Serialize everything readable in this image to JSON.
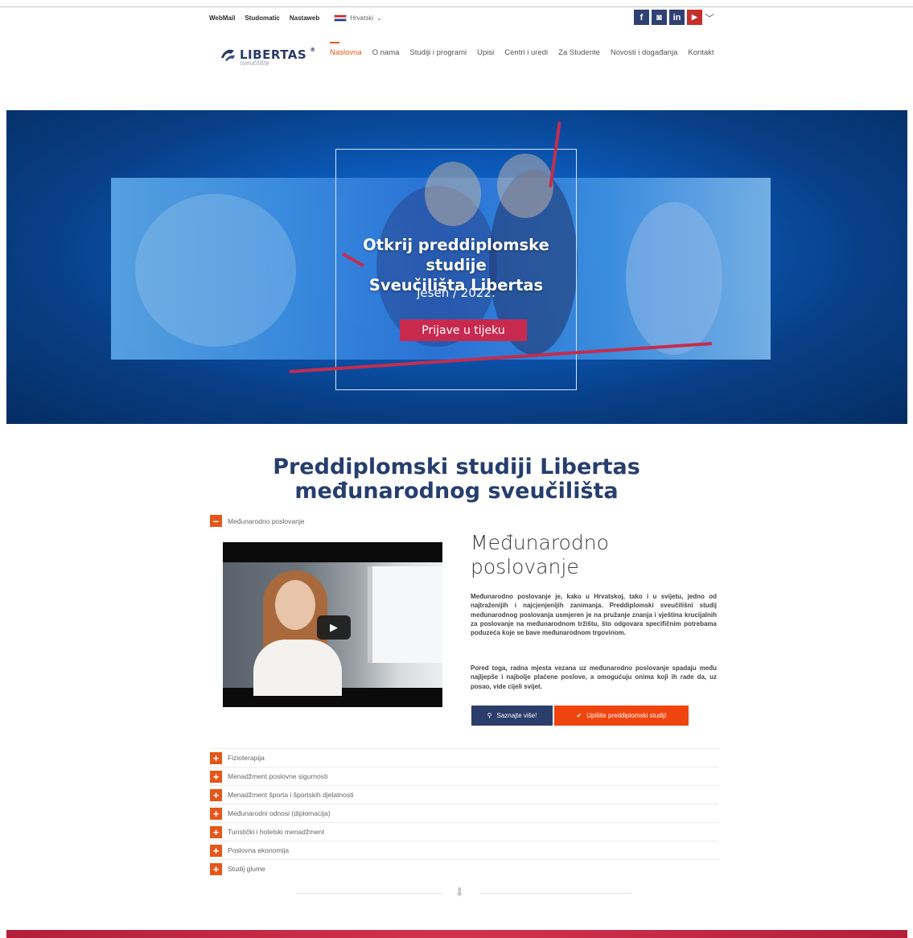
{
  "utility": {
    "links": [
      "WebMail",
      "Studomatic",
      "Nastaweb"
    ],
    "language": "Hrvatski"
  },
  "social": [
    {
      "icon": "facebook-icon",
      "glyph": "f"
    },
    {
      "icon": "instagram-icon",
      "glyph": "◙"
    },
    {
      "icon": "linkedin-icon",
      "glyph": "in"
    },
    {
      "icon": "youtube-icon",
      "glyph": "▶"
    }
  ],
  "logo": {
    "name": "LIBERTAS",
    "registered": "®",
    "sub": "sveučilište"
  },
  "nav": {
    "items": [
      "Naslovna",
      "O nama",
      "Studiji i programi",
      "Upisi",
      "Centri i uredi",
      "Za Studente",
      "Novosti i događanja",
      "Kontakt"
    ],
    "active": "Naslovna"
  },
  "hero": {
    "title_line1": "Otkrij preddiplomske studije",
    "title_line2": "Sveučilišta Libertas",
    "subtitle": "jesen / 2022.",
    "button": "Prijave u tijeku"
  },
  "section": {
    "title_line1": "Preddiplomski studiji Libertas",
    "title_line2": "međunarodnog sveučilišta"
  },
  "open_program": {
    "accordion_label": "Međunarodno poslovanje",
    "title_line1": "Međunarodno",
    "title_line2": "poslovanje",
    "paragraph1": "Međunarodno poslovanje je, kako u Hrvatskoj, tako i u svijetu, jedno od najtraženijih i najcjenjenijih zanimanja. Preddiplomski sveučilišni studij međunarodnog poslovanja usmjeren je na pružanje znanja i vještina krucijalnih za poslovanje na međunarodnom tržištu, što odgovara specifičnim potrebama poduzeća koje se bave međunarodnom trgovinom.",
    "paragraph2": "Pored toga, radna mjesta vezana uz međunarodno poslovanje spadaju među najljepše i najbolje plaćene poslove, a omogućuju onima koji ih rade da, uz posao, vide cijeli svijet.",
    "btn_more": "Saznajte više!",
    "btn_enroll": "Upišite preddiplomski studij!"
  },
  "programs": [
    "Fizioterapija",
    "Menadžment poslovne sigurnosti",
    "Menadžment športa i športskih djelatnosti",
    "Međunarodni odnosi (diplomacija)",
    "Turistički i hotelski menadžment",
    "Poslovna ekonomija",
    "Studij glume"
  ],
  "colors": {
    "accent": "#e4571b",
    "navy": "#263e6e",
    "hero_red": "#c8294f",
    "enroll": "#f0440f"
  }
}
